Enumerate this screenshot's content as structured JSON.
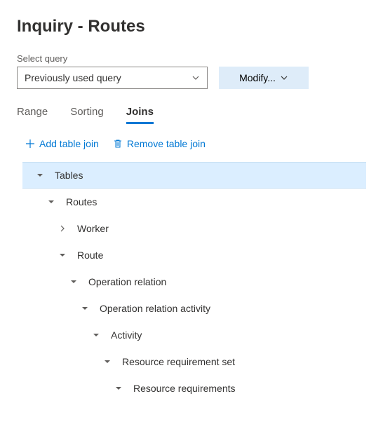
{
  "page_title": "Inquiry - Routes",
  "query": {
    "label": "Select query",
    "selected": "Previously used query"
  },
  "modify_label": "Modify...",
  "tabs": [
    "Range",
    "Sorting",
    "Joins"
  ],
  "active_tab": "Joins",
  "actions": {
    "add": "Add table join",
    "remove": "Remove table join"
  },
  "tree": [
    {
      "label": "Tables",
      "indent": 0,
      "expanded": true,
      "selected": true
    },
    {
      "label": "Routes",
      "indent": 1,
      "expanded": true
    },
    {
      "label": "Worker",
      "indent": 2,
      "expanded": false,
      "collapsed_icon": true
    },
    {
      "label": "Route",
      "indent": 2,
      "expanded": true
    },
    {
      "label": "Operation relation",
      "indent": 3,
      "expanded": true
    },
    {
      "label": "Operation relation activity",
      "indent": 4,
      "expanded": true
    },
    {
      "label": "Activity",
      "indent": 5,
      "expanded": true
    },
    {
      "label": "Resource requirement set",
      "indent": 6,
      "expanded": true
    },
    {
      "label": "Resource requirements",
      "indent": 7,
      "expanded": true
    }
  ]
}
